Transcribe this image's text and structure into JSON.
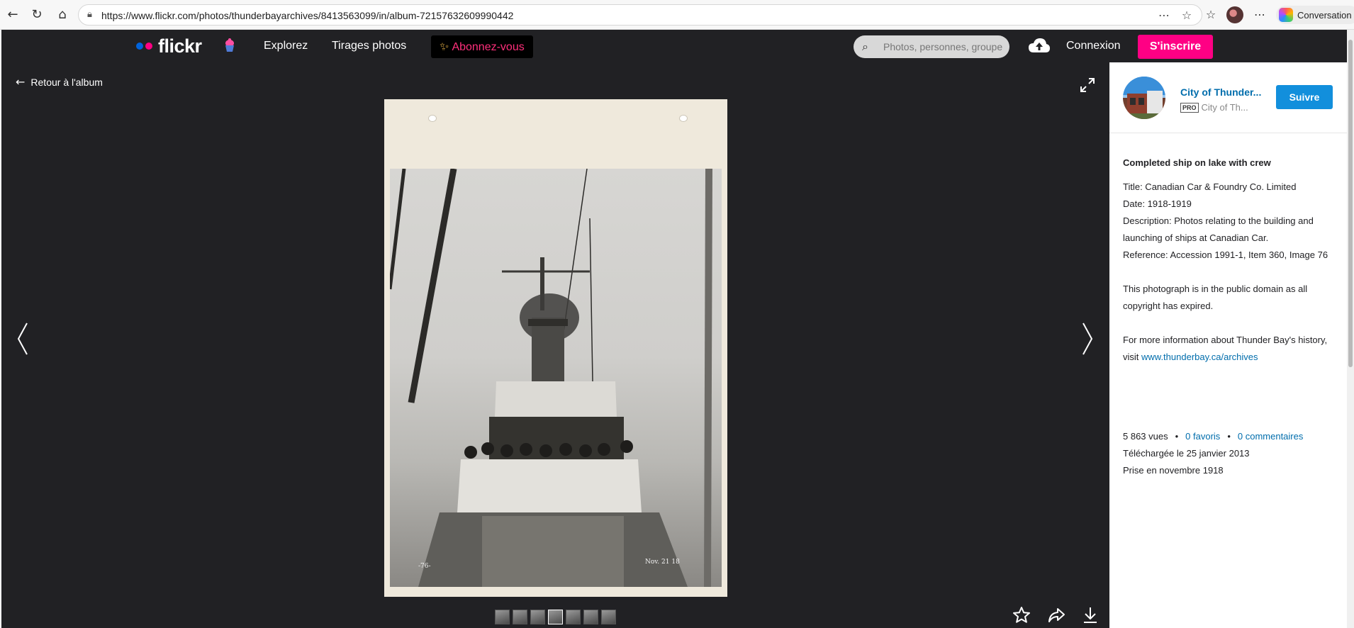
{
  "browser": {
    "url": "https://www.flickr.com/photos/thunderbayarchives/8413563099/in/album-72157632609990442",
    "copilot_label": "Conversation"
  },
  "nav": {
    "logo_text": "flickr",
    "explore": "Explorez",
    "prints": "Tirages photos",
    "subscribe": "Abonnez-vous",
    "search_placeholder": "Photos, personnes, groupes",
    "login": "Connexion",
    "signup": "S'inscrire"
  },
  "photo_view": {
    "back_label": "Retour à l'album",
    "photo_number_label": "-76-",
    "photo_date_label": "Nov. 21 18",
    "thumbnail_count": 7,
    "active_thumbnail": 3
  },
  "owner": {
    "name": "City of Thunder...",
    "badge": "PRO",
    "sub": "City of Th...",
    "follow": "Suivre"
  },
  "description": {
    "title": "Completed ship on lake with crew",
    "lines": [
      "Title: Canadian Car & Foundry Co. Limited",
      "Date: 1918-1919",
      "Description: Photos relating to the building and launching of ships at Canadian Car.",
      "Reference: Accession 1991-1, Item 360, Image 76"
    ],
    "public_domain": "This photograph is in the public domain as all copyright has expired.",
    "more_info": "For more information about Thunder Bay's history, visit ",
    "more_info_link": "www.thunderbay.ca/archives"
  },
  "stats": {
    "views": "5 863 vues",
    "favorites": "0 favoris",
    "comments": "0 commentaires",
    "uploaded": "Téléchargée le 25 janvier 2013",
    "taken": "Prise en novembre 1918"
  },
  "colors": {
    "flickr_blue": "#0063dc",
    "flickr_pink": "#ff0084",
    "follow_blue": "#128fdc",
    "link_blue": "#006dac",
    "dark_bg": "#212124"
  }
}
